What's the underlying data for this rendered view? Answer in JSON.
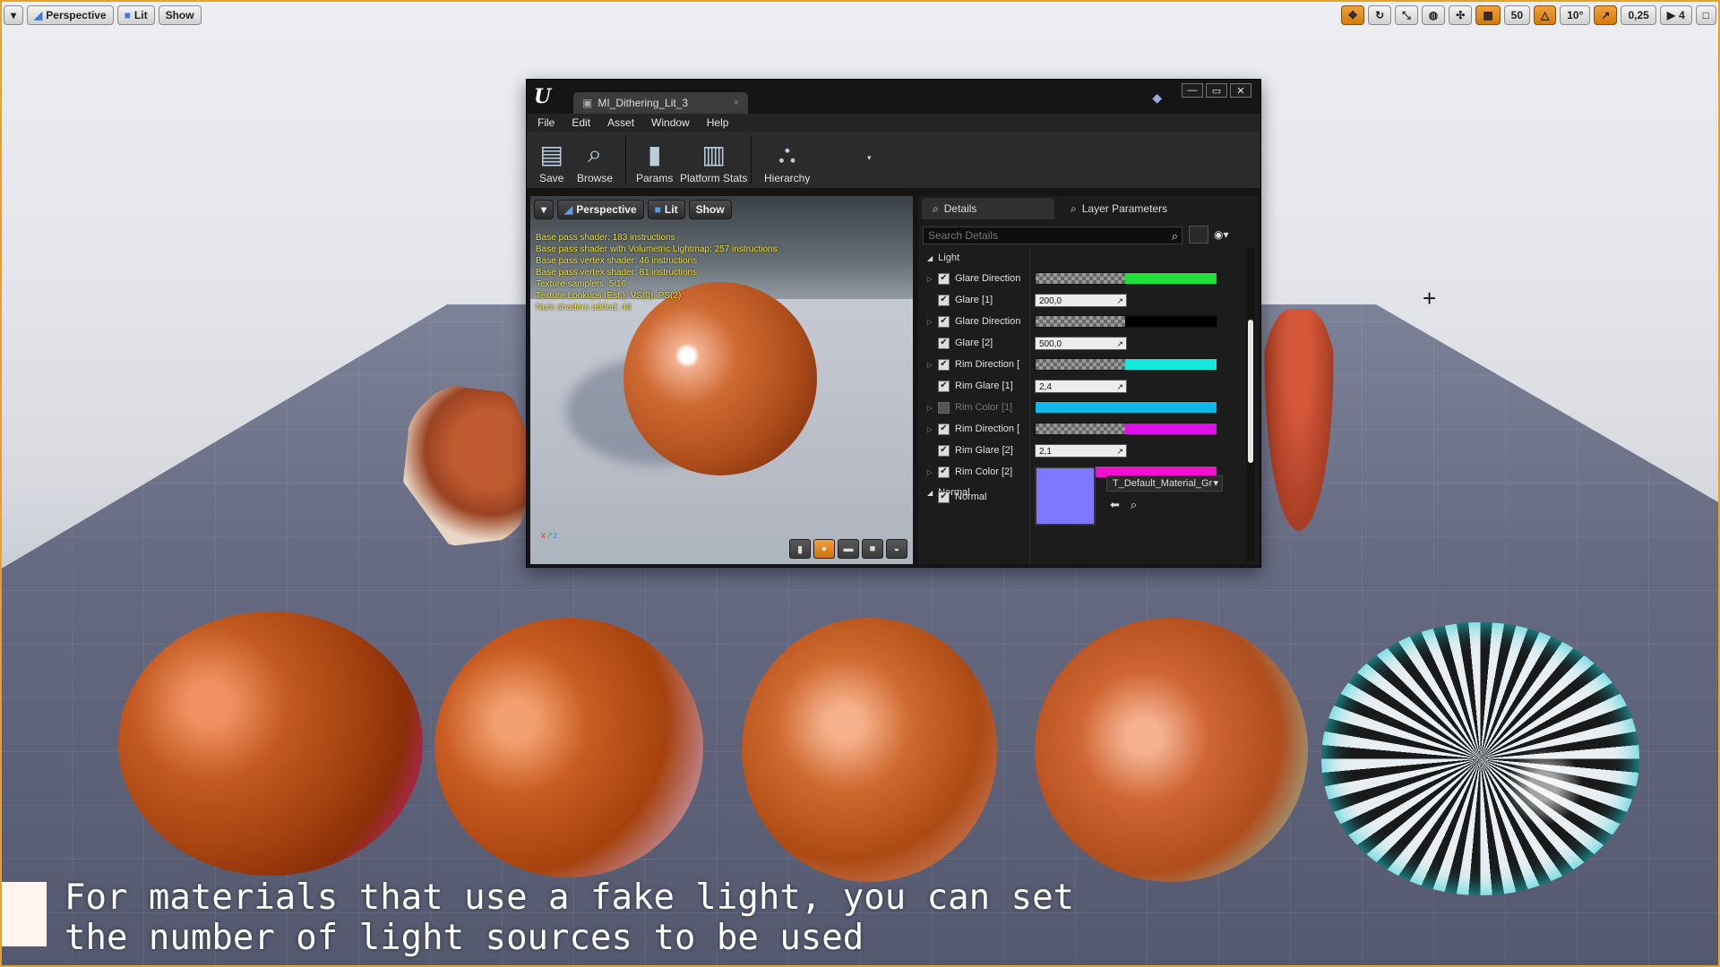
{
  "viewport": {
    "toolbar": {
      "dropdown_icon": "chevron-down-icon",
      "perspective": "Perspective",
      "lit": "Lit",
      "show": "Show"
    },
    "right_toolbar": {
      "grid_snap": "50",
      "rotate_snap": "10°",
      "scale_snap": "0,25",
      "camera_speed": "4"
    }
  },
  "material_editor": {
    "tab_title": "MI_Dithering_Lit_3",
    "menu": [
      "File",
      "Edit",
      "Asset",
      "Window",
      "Help"
    ],
    "toolbar": {
      "save": "Save",
      "browse": "Browse",
      "params": "Params",
      "platform_stats": "Platform Stats",
      "hierarchy": "Hierarchy"
    },
    "preview": {
      "perspective": "Perspective",
      "lit": "Lit",
      "show": "Show",
      "stats": [
        "Base pass shader: 183 instructions",
        "Base pass shader with Volumetric Lightmap: 257 instructions",
        "Base pass vertex shader: 46 instructions",
        "Base pass vertex shader: 81 instructions",
        "Texture samplers: 5/16",
        "Texture Lookups (Est.): VS(0), PS(2)",
        "Num shaders added: 48"
      ]
    },
    "details": {
      "tab_details": "Details",
      "tab_layer_parameters": "Layer Parameters",
      "search_placeholder": "Search Details",
      "category_light": "Light",
      "category_normal": "Normal",
      "rows": [
        {
          "name": "Glare Direction",
          "type": "color",
          "color": "#22e03a",
          "checked": true,
          "expandable": true
        },
        {
          "name": "Glare [1]",
          "type": "number",
          "value": "200,0",
          "checked": true,
          "expandable": false
        },
        {
          "name": "Glare Direction",
          "type": "color",
          "color": "#000000",
          "checked": true,
          "expandable": true
        },
        {
          "name": "Glare [2]",
          "type": "number",
          "value": "500,0",
          "checked": true,
          "expandable": false
        },
        {
          "name": "Rim Direction [",
          "type": "color",
          "color": "#12e8e0",
          "checked": true,
          "expandable": true
        },
        {
          "name": "Rim Glare [1]",
          "type": "number",
          "value": "2,4",
          "checked": true,
          "expandable": false
        },
        {
          "name": "Rim Color [1]",
          "type": "solid",
          "color": "#10b8ea",
          "checked": false,
          "expandable": true
        },
        {
          "name": "Rim Direction [",
          "type": "color",
          "color": "#e010e8",
          "checked": true,
          "expandable": true
        },
        {
          "name": "Rim Glare [2]",
          "type": "number",
          "value": "2,1",
          "checked": true,
          "expandable": false
        },
        {
          "name": "Rim Color [2]",
          "type": "solid",
          "color": "#f010d0",
          "checked": true,
          "expandable": true
        }
      ],
      "normal_label": "Normal",
      "normal_texture": "T_Default_Material_Gr",
      "normal_swatch_color": "#7c79ff"
    },
    "window_controls": [
      "minimize-icon",
      "maximize-icon",
      "close-icon"
    ]
  },
  "caption": {
    "line1": "For materials that use a fake light, you can set",
    "line2": "the number of light sources to be used"
  }
}
